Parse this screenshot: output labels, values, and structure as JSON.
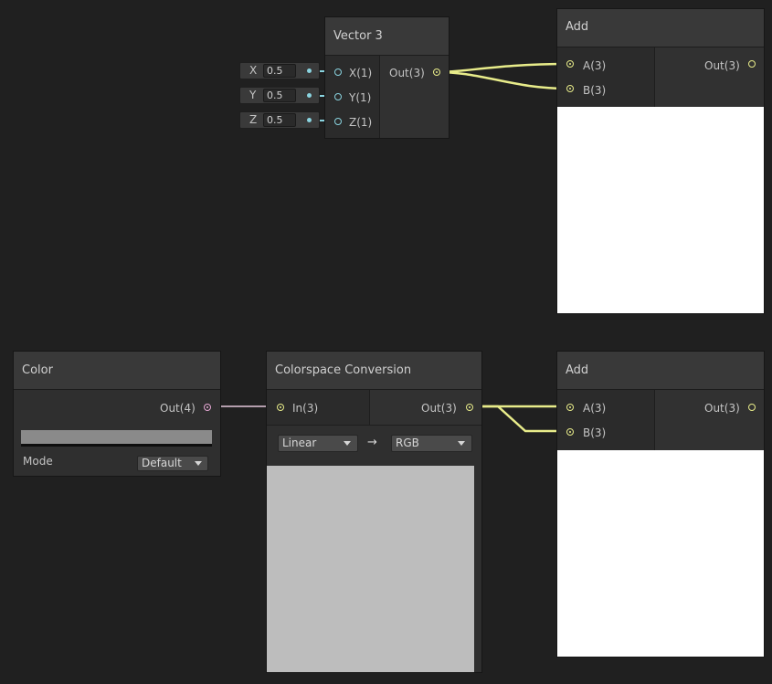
{
  "vector3_node": {
    "title": "Vector 3",
    "inputs": [
      "X(1)",
      "Y(1)",
      "Z(1)"
    ],
    "output": "Out(3)",
    "fields": [
      {
        "label": "X",
        "value": "0.5"
      },
      {
        "label": "Y",
        "value": "0.5"
      },
      {
        "label": "Z",
        "value": "0.5"
      }
    ]
  },
  "add_node_top": {
    "title": "Add",
    "inputs": [
      "A(3)",
      "B(3)"
    ],
    "output": "Out(3)"
  },
  "color_node": {
    "title": "Color",
    "output": "Out(4)",
    "swatch_color": "#8a8a8a",
    "mode_label": "Mode",
    "mode_value": "Default"
  },
  "colorspace_node": {
    "title": "Colorspace Conversion",
    "input": "In(3)",
    "output": "Out(3)",
    "from_value": "Linear",
    "arrow": "→",
    "to_value": "RGB"
  },
  "add_node_bottom": {
    "title": "Add",
    "inputs": [
      "A(3)",
      "B(3)"
    ],
    "output": "Out(3)"
  },
  "colors": {
    "vector3_wire": "#e8ec8a",
    "float_wire": "#8ad4e0",
    "vector4_wire": "#e6a8d4",
    "background": "#202020"
  }
}
